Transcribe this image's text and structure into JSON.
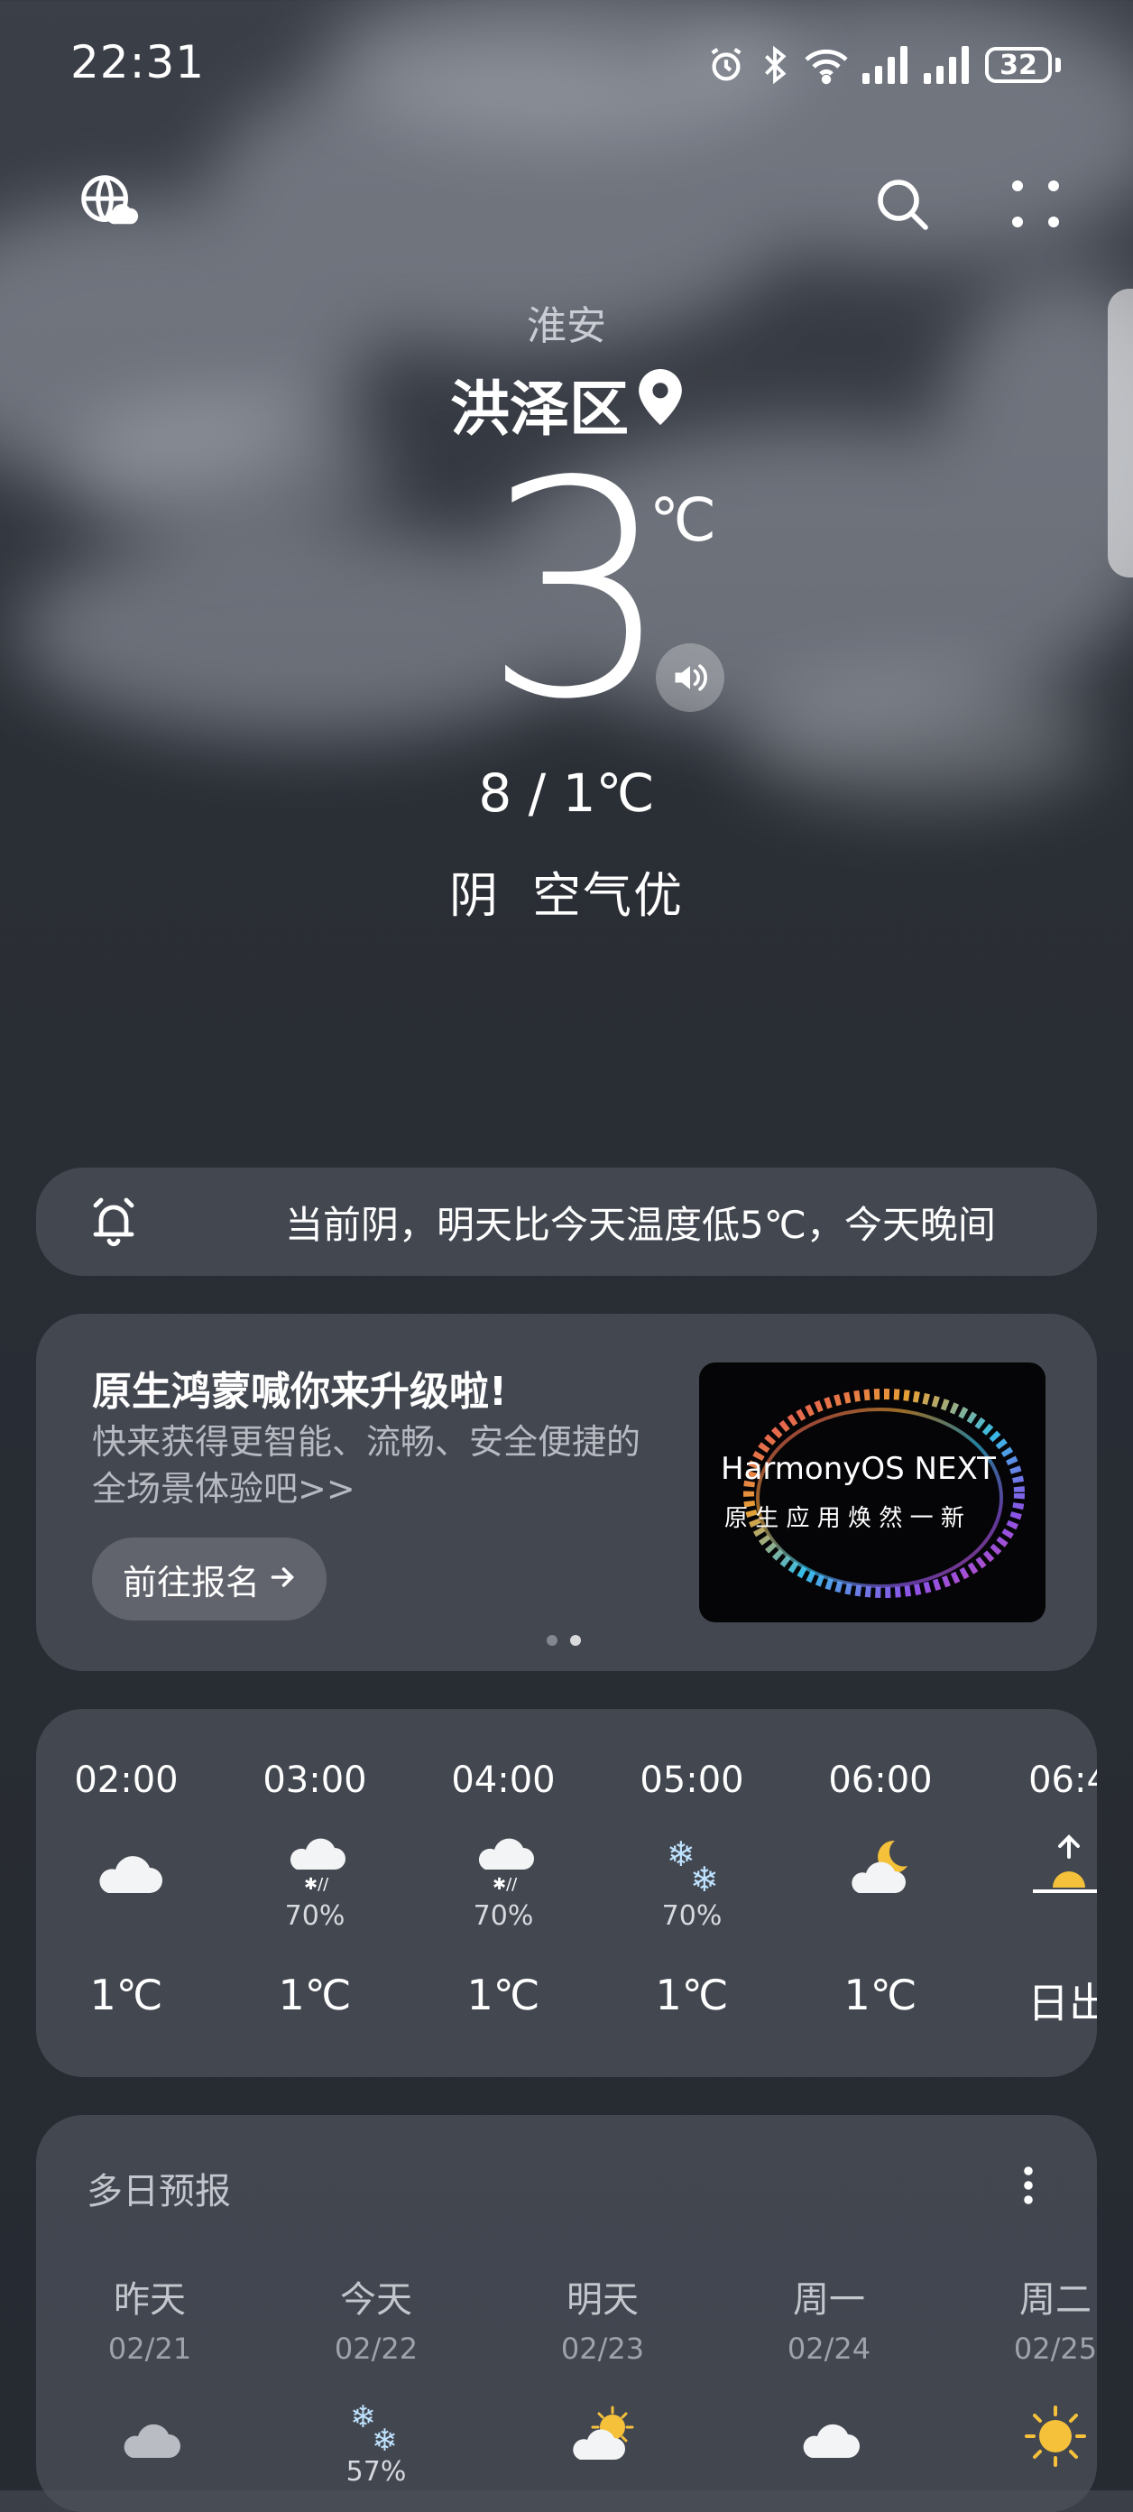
{
  "status_bar": {
    "time": "22:31",
    "battery": "32",
    "icons": [
      "alarm-icon",
      "bluetooth-icon",
      "wifi-icon",
      "signal-icon",
      "signal-icon",
      "battery-icon"
    ]
  },
  "location": {
    "city": "淮安",
    "district": "洪泽区"
  },
  "current": {
    "temperature": "3",
    "unit": "℃",
    "range": "8 / 1℃",
    "condition": "阴",
    "air_quality": "空气优"
  },
  "alert": {
    "text": "当前阴，明天比今天温度低5℃，今天晚间"
  },
  "promo": {
    "title": "原生鸿蒙喊你来升级啦!",
    "subtitle": "快来获得更智能、流畅、安全便捷的全场景体验吧>>",
    "button": "前往报名",
    "image_title": "HarmonyOS NEXT",
    "image_subtitle": "原 生 应 用   焕 然 一 新"
  },
  "hourly": [
    {
      "time": "02:00",
      "icon": "cloudy-icon",
      "precip": "",
      "temp": "1℃"
    },
    {
      "time": "03:00",
      "icon": "sleet-icon",
      "precip": "70%",
      "temp": "1℃"
    },
    {
      "time": "04:00",
      "icon": "sleet-icon",
      "precip": "70%",
      "temp": "1℃"
    },
    {
      "time": "05:00",
      "icon": "snow-icon",
      "precip": "70%",
      "temp": "1℃"
    },
    {
      "time": "06:00",
      "icon": "cloudy-night-icon",
      "precip": "",
      "temp": "1℃"
    },
    {
      "time": "06:4",
      "icon": "sunrise-icon",
      "precip": "",
      "temp": "日出"
    }
  ],
  "daily": {
    "title": "多日预报",
    "days": [
      {
        "day": "昨天",
        "date": "02/21",
        "icon": "cloudy-icon",
        "precip": ""
      },
      {
        "day": "今天",
        "date": "02/22",
        "icon": "snow-icon",
        "precip": "57%"
      },
      {
        "day": "明天",
        "date": "02/23",
        "icon": "partly-cloudy-icon",
        "precip": ""
      },
      {
        "day": "周一",
        "date": "02/24",
        "icon": "cloudy-icon",
        "precip": ""
      },
      {
        "day": "周二",
        "date": "02/25",
        "icon": "sunny-icon",
        "precip": ""
      }
    ]
  },
  "colors": {
    "background": "#2a2e35",
    "card": "#4e525c",
    "accent_sun": "#f5c13b"
  }
}
